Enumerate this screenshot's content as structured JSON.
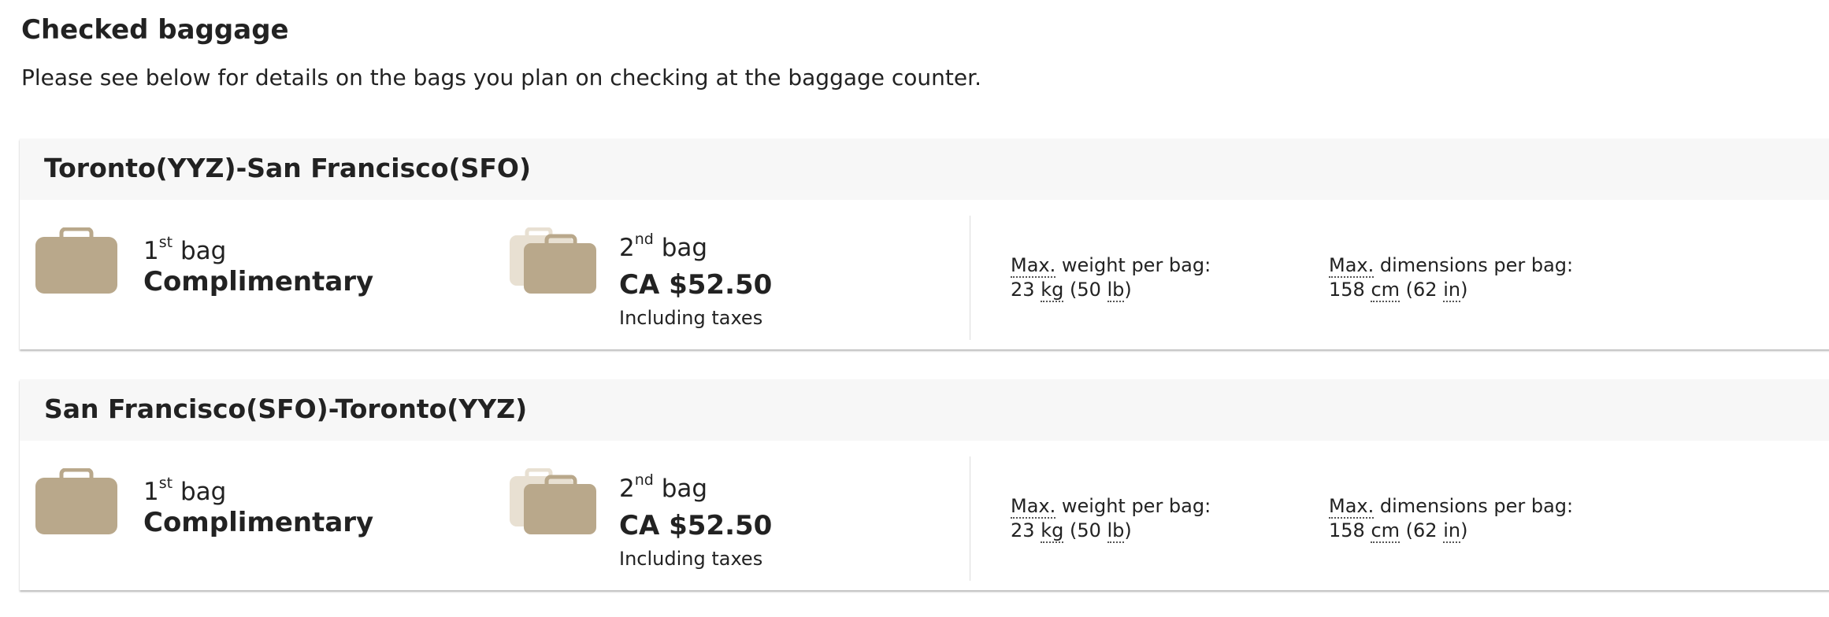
{
  "header": {
    "title": "Checked baggage",
    "subtitle": "Please see below for details on the bags you plan on checking at the baggage counter."
  },
  "colors": {
    "bag_primary": "#b9a88b",
    "bag_secondary": "#e8e0d2",
    "header_bg": "#f7f7f7"
  },
  "segments": [
    {
      "route": "Toronto(YYZ)-San Francisco(SFO)",
      "bag1": {
        "num": "1",
        "sup": "st",
        "word": "bag",
        "price": "Complimentary"
      },
      "bag2": {
        "num": "2",
        "sup": "nd",
        "word": "bag",
        "price": "CA $52.50",
        "note": "Including taxes"
      },
      "weight": {
        "max": "Max.",
        "label": "weight per bag:",
        "val1": "23",
        "unit1": "kg",
        "val2": "(50",
        "unit2": "lb",
        "close": ")"
      },
      "dims": {
        "max": "Max.",
        "label": "dimensions per bag:",
        "val1": "158",
        "unit1": "cm",
        "val2": "(62",
        "unit2": "in",
        "close": ")"
      }
    },
    {
      "route": "San Francisco(SFO)-Toronto(YYZ)",
      "bag1": {
        "num": "1",
        "sup": "st",
        "word": "bag",
        "price": "Complimentary"
      },
      "bag2": {
        "num": "2",
        "sup": "nd",
        "word": "bag",
        "price": "CA $52.50",
        "note": "Including taxes"
      },
      "weight": {
        "max": "Max.",
        "label": "weight per bag:",
        "val1": "23",
        "unit1": "kg",
        "val2": "(50",
        "unit2": "lb",
        "close": ")"
      },
      "dims": {
        "max": "Max.",
        "label": "dimensions per bag:",
        "val1": "158",
        "unit1": "cm",
        "val2": "(62",
        "unit2": "in",
        "close": ")"
      }
    }
  ]
}
